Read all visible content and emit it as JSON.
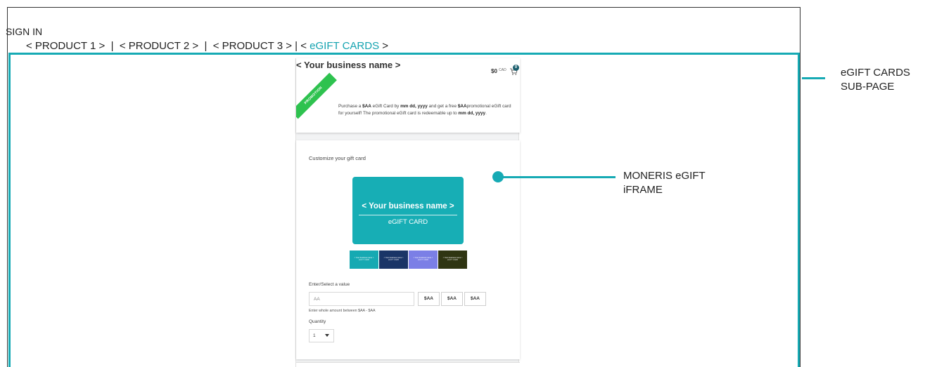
{
  "site": {
    "sign_in": "SIGN IN",
    "nav": {
      "p1": "< PRODUCT 1 >",
      "p2": "< PRODUCT 2 >",
      "p3": "< PRODUCT 3 >",
      "sep": "|",
      "lt": "<",
      "egift": "eGIFT CARDS",
      "gt": ">"
    }
  },
  "callouts": {
    "subpage_line1": "eGIFT CARDS",
    "subpage_line2": "SUB-PAGE",
    "iframe_line1": "MONERIS eGIFT",
    "iframe_line2": "iFRAME"
  },
  "iframe": {
    "business_title": "< Your business name >",
    "cart": {
      "total": "$0",
      "currency": "CAD",
      "count": "0",
      "icon": "cart-icon"
    },
    "promotion": {
      "ribbon": "PROMOTION",
      "t1": "Purchase a ",
      "amount1": "$AA",
      "t2": " eGift Card by ",
      "date1": "mm dd, yyyy",
      "t3": " and get a free ",
      "amount2": "$AA",
      "t4": "promotional eGift card for yourself! The promotional eGift card is redeemable up to ",
      "date2": "mm dd, yyyy",
      "t5": "."
    },
    "customize_label": "Customize your gift card",
    "card_preview": {
      "name": "< Your business name >",
      "sub": "eGIFT CARD",
      "color": "#17aeb5"
    },
    "designs": [
      {
        "name": "< Your business name >",
        "sub": "eGIFT CARD",
        "color": "#16a9b2"
      },
      {
        "name": "< Your business name >",
        "sub": "eGIFT CARD",
        "color": "#1a3567"
      },
      {
        "name": "< Your business name >",
        "sub": "eGIFT CARD",
        "color": "#7b7fe6"
      },
      {
        "name": "< Your business name >",
        "sub": "eGIFT CARD",
        "color": "#2f3512"
      }
    ],
    "value_label": "Enter/Select a value",
    "value_placeholder": "AA",
    "presets": [
      "$AA",
      "$AA",
      "$AA"
    ],
    "value_help": "Enter whole amount between $AA - $AA",
    "quantity_label": "Quantity",
    "quantity_value": "1"
  },
  "colors": {
    "accent": "#16aab4",
    "promo": "#2ec24f"
  }
}
